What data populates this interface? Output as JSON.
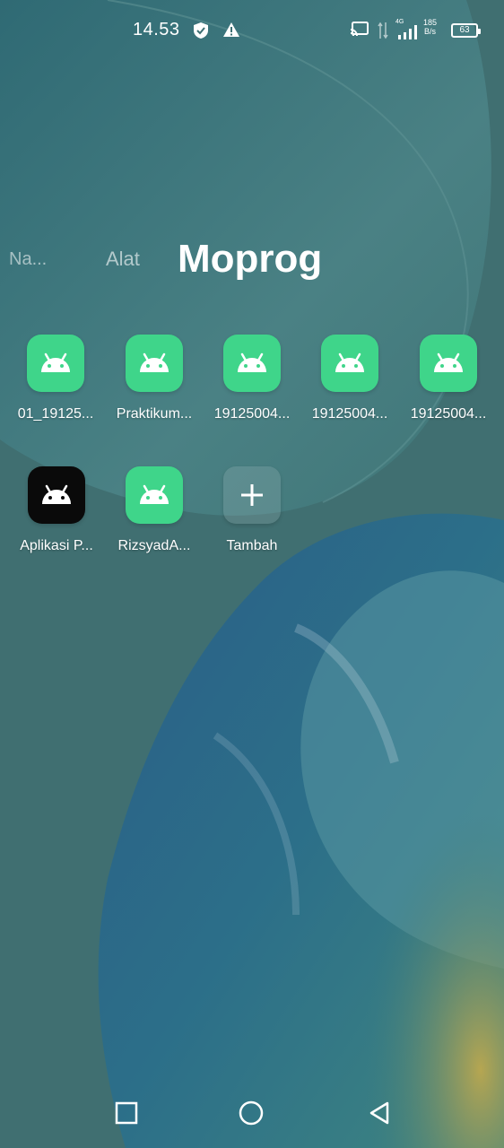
{
  "status_bar": {
    "time": "14.53",
    "network_type": "4G",
    "speed_top": "185",
    "speed_bottom": "B/s",
    "battery": "63",
    "icons": [
      "shield-icon",
      "warning-icon",
      "cast-icon",
      "data-arrows-icon",
      "signal-icon"
    ]
  },
  "folder_tabs": {
    "left_partial": "Na...",
    "second": "Alat",
    "active": "Moprog"
  },
  "apps": [
    {
      "label": "01_19125...",
      "icon": "android-icon"
    },
    {
      "label": "Praktikum...",
      "icon": "android-icon"
    },
    {
      "label": "19125004...",
      "icon": "android-icon"
    },
    {
      "label": "19125004...",
      "icon": "android-icon"
    },
    {
      "label": "19125004...",
      "icon": "android-icon"
    },
    {
      "label": "Aplikasi P...",
      "icon": "android-icon"
    },
    {
      "label": "RizsyadA...",
      "icon": "android-icon"
    }
  ],
  "add_button": {
    "label": "Tambah",
    "icon": "plus-icon"
  },
  "nav_bar": {
    "icons": [
      "recents-square-icon",
      "home-circle-icon",
      "back-triangle-icon"
    ]
  },
  "colors": {
    "app_icon_bg": "#3fd58a",
    "dark_icon_bg": "#0a0a0a",
    "wallpaper_base": "#3d6f73"
  }
}
